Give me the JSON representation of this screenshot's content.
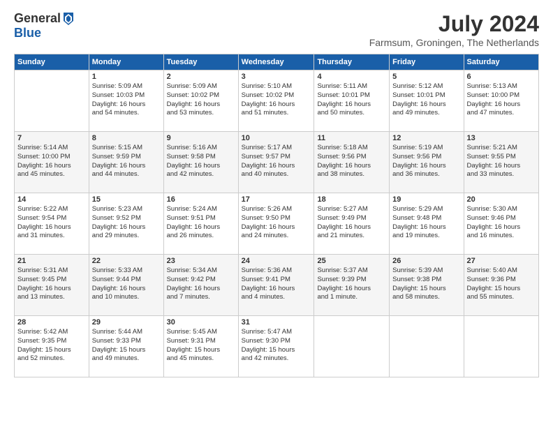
{
  "logo": {
    "general": "General",
    "blue": "Blue"
  },
  "header": {
    "month": "July 2024",
    "location": "Farmsum, Groningen, The Netherlands"
  },
  "weekdays": [
    "Sunday",
    "Monday",
    "Tuesday",
    "Wednesday",
    "Thursday",
    "Friday",
    "Saturday"
  ],
  "weeks": [
    [
      {
        "day": "",
        "content": ""
      },
      {
        "day": "1",
        "content": "Sunrise: 5:09 AM\nSunset: 10:03 PM\nDaylight: 16 hours\nand 54 minutes."
      },
      {
        "day": "2",
        "content": "Sunrise: 5:09 AM\nSunset: 10:02 PM\nDaylight: 16 hours\nand 53 minutes."
      },
      {
        "day": "3",
        "content": "Sunrise: 5:10 AM\nSunset: 10:02 PM\nDaylight: 16 hours\nand 51 minutes."
      },
      {
        "day": "4",
        "content": "Sunrise: 5:11 AM\nSunset: 10:01 PM\nDaylight: 16 hours\nand 50 minutes."
      },
      {
        "day": "5",
        "content": "Sunrise: 5:12 AM\nSunset: 10:01 PM\nDaylight: 16 hours\nand 49 minutes."
      },
      {
        "day": "6",
        "content": "Sunrise: 5:13 AM\nSunset: 10:00 PM\nDaylight: 16 hours\nand 47 minutes."
      }
    ],
    [
      {
        "day": "7",
        "content": "Sunrise: 5:14 AM\nSunset: 10:00 PM\nDaylight: 16 hours\nand 45 minutes."
      },
      {
        "day": "8",
        "content": "Sunrise: 5:15 AM\nSunset: 9:59 PM\nDaylight: 16 hours\nand 44 minutes."
      },
      {
        "day": "9",
        "content": "Sunrise: 5:16 AM\nSunset: 9:58 PM\nDaylight: 16 hours\nand 42 minutes."
      },
      {
        "day": "10",
        "content": "Sunrise: 5:17 AM\nSunset: 9:57 PM\nDaylight: 16 hours\nand 40 minutes."
      },
      {
        "day": "11",
        "content": "Sunrise: 5:18 AM\nSunset: 9:56 PM\nDaylight: 16 hours\nand 38 minutes."
      },
      {
        "day": "12",
        "content": "Sunrise: 5:19 AM\nSunset: 9:56 PM\nDaylight: 16 hours\nand 36 minutes."
      },
      {
        "day": "13",
        "content": "Sunrise: 5:21 AM\nSunset: 9:55 PM\nDaylight: 16 hours\nand 33 minutes."
      }
    ],
    [
      {
        "day": "14",
        "content": "Sunrise: 5:22 AM\nSunset: 9:54 PM\nDaylight: 16 hours\nand 31 minutes."
      },
      {
        "day": "15",
        "content": "Sunrise: 5:23 AM\nSunset: 9:52 PM\nDaylight: 16 hours\nand 29 minutes."
      },
      {
        "day": "16",
        "content": "Sunrise: 5:24 AM\nSunset: 9:51 PM\nDaylight: 16 hours\nand 26 minutes."
      },
      {
        "day": "17",
        "content": "Sunrise: 5:26 AM\nSunset: 9:50 PM\nDaylight: 16 hours\nand 24 minutes."
      },
      {
        "day": "18",
        "content": "Sunrise: 5:27 AM\nSunset: 9:49 PM\nDaylight: 16 hours\nand 21 minutes."
      },
      {
        "day": "19",
        "content": "Sunrise: 5:29 AM\nSunset: 9:48 PM\nDaylight: 16 hours\nand 19 minutes."
      },
      {
        "day": "20",
        "content": "Sunrise: 5:30 AM\nSunset: 9:46 PM\nDaylight: 16 hours\nand 16 minutes."
      }
    ],
    [
      {
        "day": "21",
        "content": "Sunrise: 5:31 AM\nSunset: 9:45 PM\nDaylight: 16 hours\nand 13 minutes."
      },
      {
        "day": "22",
        "content": "Sunrise: 5:33 AM\nSunset: 9:44 PM\nDaylight: 16 hours\nand 10 minutes."
      },
      {
        "day": "23",
        "content": "Sunrise: 5:34 AM\nSunset: 9:42 PM\nDaylight: 16 hours\nand 7 minutes."
      },
      {
        "day": "24",
        "content": "Sunrise: 5:36 AM\nSunset: 9:41 PM\nDaylight: 16 hours\nand 4 minutes."
      },
      {
        "day": "25",
        "content": "Sunrise: 5:37 AM\nSunset: 9:39 PM\nDaylight: 16 hours\nand 1 minute."
      },
      {
        "day": "26",
        "content": "Sunrise: 5:39 AM\nSunset: 9:38 PM\nDaylight: 15 hours\nand 58 minutes."
      },
      {
        "day": "27",
        "content": "Sunrise: 5:40 AM\nSunset: 9:36 PM\nDaylight: 15 hours\nand 55 minutes."
      }
    ],
    [
      {
        "day": "28",
        "content": "Sunrise: 5:42 AM\nSunset: 9:35 PM\nDaylight: 15 hours\nand 52 minutes."
      },
      {
        "day": "29",
        "content": "Sunrise: 5:44 AM\nSunset: 9:33 PM\nDaylight: 15 hours\nand 49 minutes."
      },
      {
        "day": "30",
        "content": "Sunrise: 5:45 AM\nSunset: 9:31 PM\nDaylight: 15 hours\nand 45 minutes."
      },
      {
        "day": "31",
        "content": "Sunrise: 5:47 AM\nSunset: 9:30 PM\nDaylight: 15 hours\nand 42 minutes."
      },
      {
        "day": "",
        "content": ""
      },
      {
        "day": "",
        "content": ""
      },
      {
        "day": "",
        "content": ""
      }
    ]
  ]
}
